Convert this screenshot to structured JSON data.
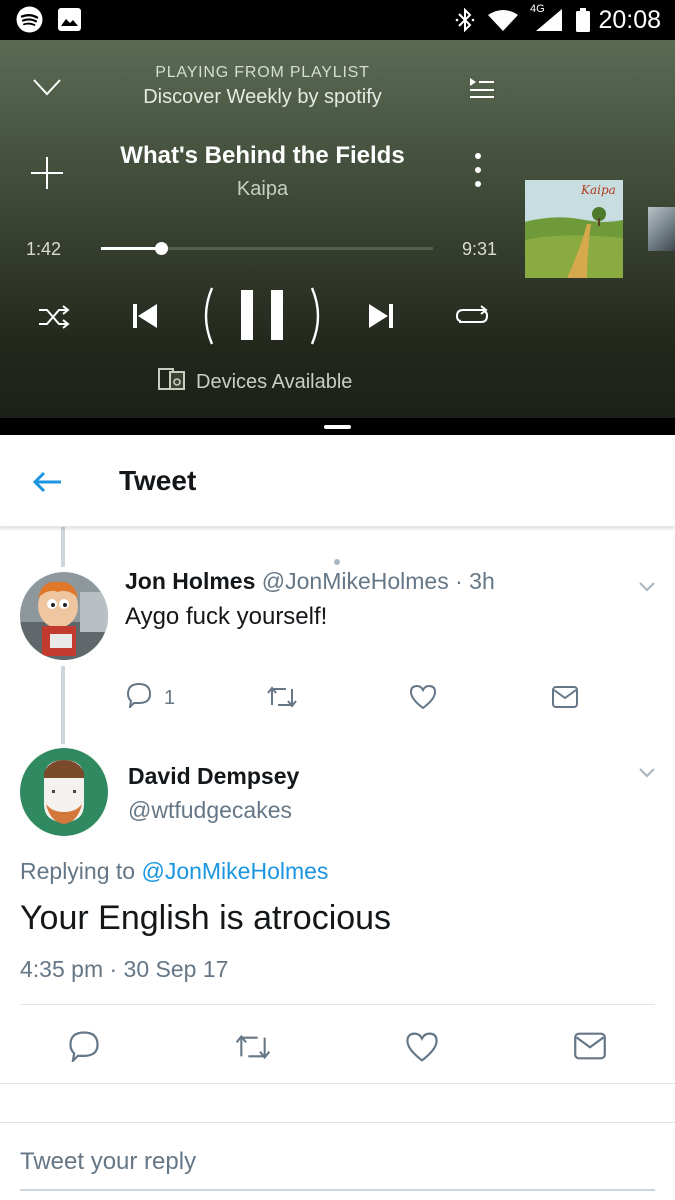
{
  "status_bar": {
    "time": "20:08",
    "network": "4G",
    "icons": [
      "spotify-icon",
      "image-icon",
      "bluetooth-icon",
      "wifi-icon",
      "signal-icon",
      "battery-icon"
    ]
  },
  "player": {
    "context_label": "PLAYING FROM PLAYLIST",
    "playlist_name": "Discover Weekly by spotify",
    "track_title": "What's Behind the Fields",
    "artist": "Kaipa",
    "elapsed": "1:42",
    "duration": "9:31",
    "progress": 0.18,
    "devices_label": "Devices Available",
    "album_text": "Kaipa",
    "colors": {
      "background": "#3c4634",
      "text": "#ffffff"
    }
  },
  "tweet_screen": {
    "back_icon": "back-arrow-icon",
    "title": "Tweet",
    "accent": "#1b95e0",
    "reply_tweet": {
      "name": "Jon Holmes",
      "handle": "@JonMikeHolmes",
      "age": "· 3h",
      "text": "Aygo fuck yourself!",
      "reply_count": "1"
    },
    "main_tweet": {
      "name": "David Dempsey",
      "handle": "@wtfudgecakes",
      "replying_prefix": "Replying to",
      "replying_to": "@JonMikeHolmes",
      "text": "Your English is atrocious",
      "timestamp": "4:35 pm · 30 Sep 17"
    },
    "reply_placeholder": "Tweet your reply"
  }
}
